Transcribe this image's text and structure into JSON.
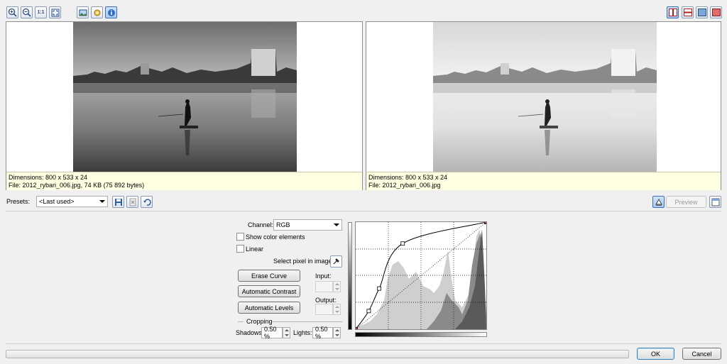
{
  "toolbar_left": [
    {
      "name": "zoom-in-icon"
    },
    {
      "name": "zoom-out-icon"
    },
    {
      "name": "actual-size-icon",
      "glyph": "1:1"
    },
    {
      "name": "fit-to-window-icon"
    },
    {
      "name": "image-icon"
    },
    {
      "name": "settings-icon"
    },
    {
      "name": "info-icon"
    }
  ],
  "toolbar_right": [
    {
      "name": "split-vertical-icon"
    },
    {
      "name": "split-horizontal-icon"
    },
    {
      "name": "single-view-icon"
    },
    {
      "name": "original-view-icon"
    }
  ],
  "left_panel": {
    "dimensions": "Dimensions: 800 x 533 x 24",
    "file": "File: 2012_rybari_006.jpg, 74 KB (75 892 bytes)"
  },
  "right_panel": {
    "dimensions": "Dimensions: 800 x 533 x 24",
    "file": "File: 2012_rybari_006.jpg"
  },
  "presets": {
    "label": "Presets:",
    "value": "<Last used>"
  },
  "preview_label": "Preview",
  "controls": {
    "channel_label": "Channel:",
    "channel_value": "RGB",
    "show_color_elements": "Show color elements",
    "linear": "Linear",
    "select_pixel": "Select pixel in image:",
    "erase_curve": "Erase Curve",
    "automatic_contrast": "Automatic Contrast",
    "automatic_levels": "Automatic Levels",
    "input_label": "Input:",
    "output_label": "Output:",
    "cropping_label": "Cropping",
    "shadows_label": "Shadows:",
    "shadows_value": "0.50 %",
    "lights_label": "Lights:",
    "lights_value": "0.50 %"
  },
  "curve": {
    "points": [
      [
        0,
        0
      ],
      [
        0.1,
        0.17
      ],
      [
        0.18,
        0.38
      ],
      [
        0.36,
        0.8
      ],
      [
        1,
        1
      ]
    ]
  },
  "footer": {
    "ok": "OK",
    "cancel": "Cancel"
  }
}
